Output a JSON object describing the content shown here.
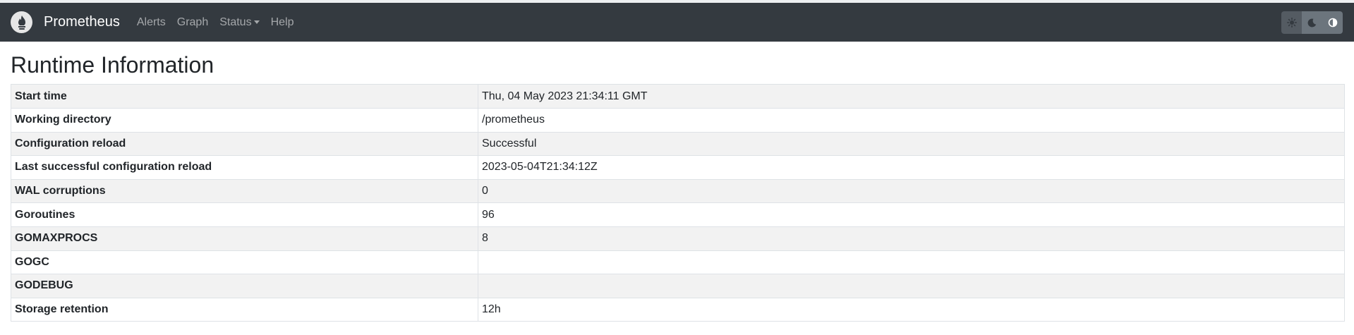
{
  "navbar": {
    "brand": "Prometheus",
    "links": [
      "Alerts",
      "Graph",
      "Status",
      "Help"
    ]
  },
  "theme_switcher": {
    "options": [
      "light-theme-icon",
      "dark-theme-icon",
      "browser-default-theme-icon"
    ]
  },
  "page": {
    "title": "Runtime Information"
  },
  "runtime_info": {
    "rows": [
      {
        "key": "Start time",
        "value": "Thu, 04 May 2023 21:34:11 GMT"
      },
      {
        "key": "Working directory",
        "value": "/prometheus"
      },
      {
        "key": "Configuration reload",
        "value": "Successful"
      },
      {
        "key": "Last successful configuration reload",
        "value": "2023-05-04T21:34:12Z"
      },
      {
        "key": "WAL corruptions",
        "value": "0"
      },
      {
        "key": "Goroutines",
        "value": "96"
      },
      {
        "key": "GOMAXPROCS",
        "value": "8"
      },
      {
        "key": "GOGC",
        "value": ""
      },
      {
        "key": "GODEBUG",
        "value": ""
      },
      {
        "key": "Storage retention",
        "value": "12h"
      }
    ]
  },
  "colors": {
    "navbar_bg": "#343a40",
    "row_stripe": "#f2f2f2",
    "theme_button": "#6c757d"
  }
}
